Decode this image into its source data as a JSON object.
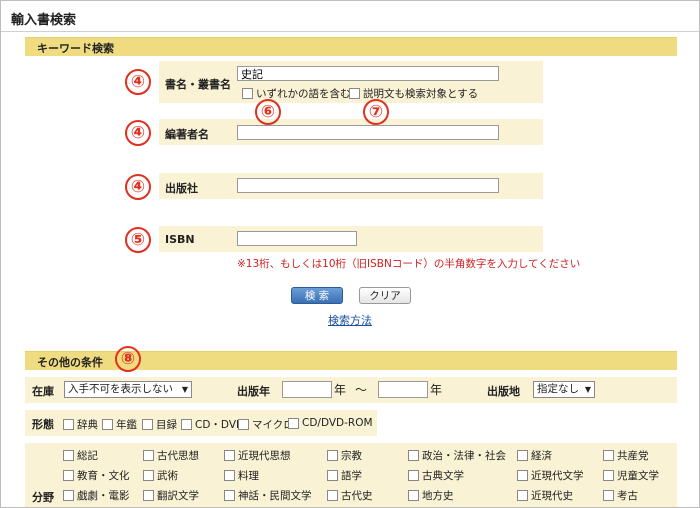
{
  "page": {
    "title": "輸入書検索"
  },
  "keyword_section": {
    "header": "キーワード検索",
    "title_field": {
      "label": "書名・叢書名",
      "value": "史記"
    },
    "options": [
      "いずれかの語を含む",
      "説明文も検索対象とする"
    ],
    "author_field": {
      "label": "編著者名",
      "value": ""
    },
    "publisher_field": {
      "label": "出版社",
      "value": ""
    },
    "isbn_field": {
      "label": "ISBN",
      "value": ""
    },
    "isbn_note": "※13桁、もしくは10桁（旧ISBNコード）の半角数字を入力してください",
    "search_button": "検 索",
    "clear_button": "クリア",
    "help_link": "検索方法"
  },
  "annotations": {
    "n4": "④",
    "n5": "⑤",
    "n6": "⑥",
    "n7": "⑦",
    "n8": "⑧"
  },
  "other_section": {
    "header": "その他の条件",
    "stock": {
      "label": "在庫",
      "selected": "入手不可を表示しない"
    },
    "year": {
      "label": "出版年",
      "nen": "年",
      "tilde": "～"
    },
    "place": {
      "label": "出版地",
      "selected": "指定なし"
    },
    "format": {
      "label": "形態",
      "items": [
        "辞典",
        "年鑑",
        "目録",
        "CD・DVD",
        "マイクロ",
        "CD/DVD-ROM"
      ]
    },
    "field": {
      "label": "分野",
      "items": [
        "総記",
        "古代思想",
        "近現代思想",
        "宗教",
        "政治・法律・社会",
        "経済",
        "共産党",
        "教育・文化",
        "武術",
        "料理",
        "語学",
        "古典文学",
        "近現代文学",
        "児童文学",
        "戯劇・電影",
        "翻訳文学",
        "神話・民間文学",
        "古代史",
        "地方史",
        "近現代史",
        "考古"
      ]
    }
  },
  "colors": {
    "section_bar": "#f0dc80",
    "label_bg": "#f9f2d4",
    "badge": "#e03020",
    "note": "#d02020",
    "link": "#1a4fa0"
  }
}
